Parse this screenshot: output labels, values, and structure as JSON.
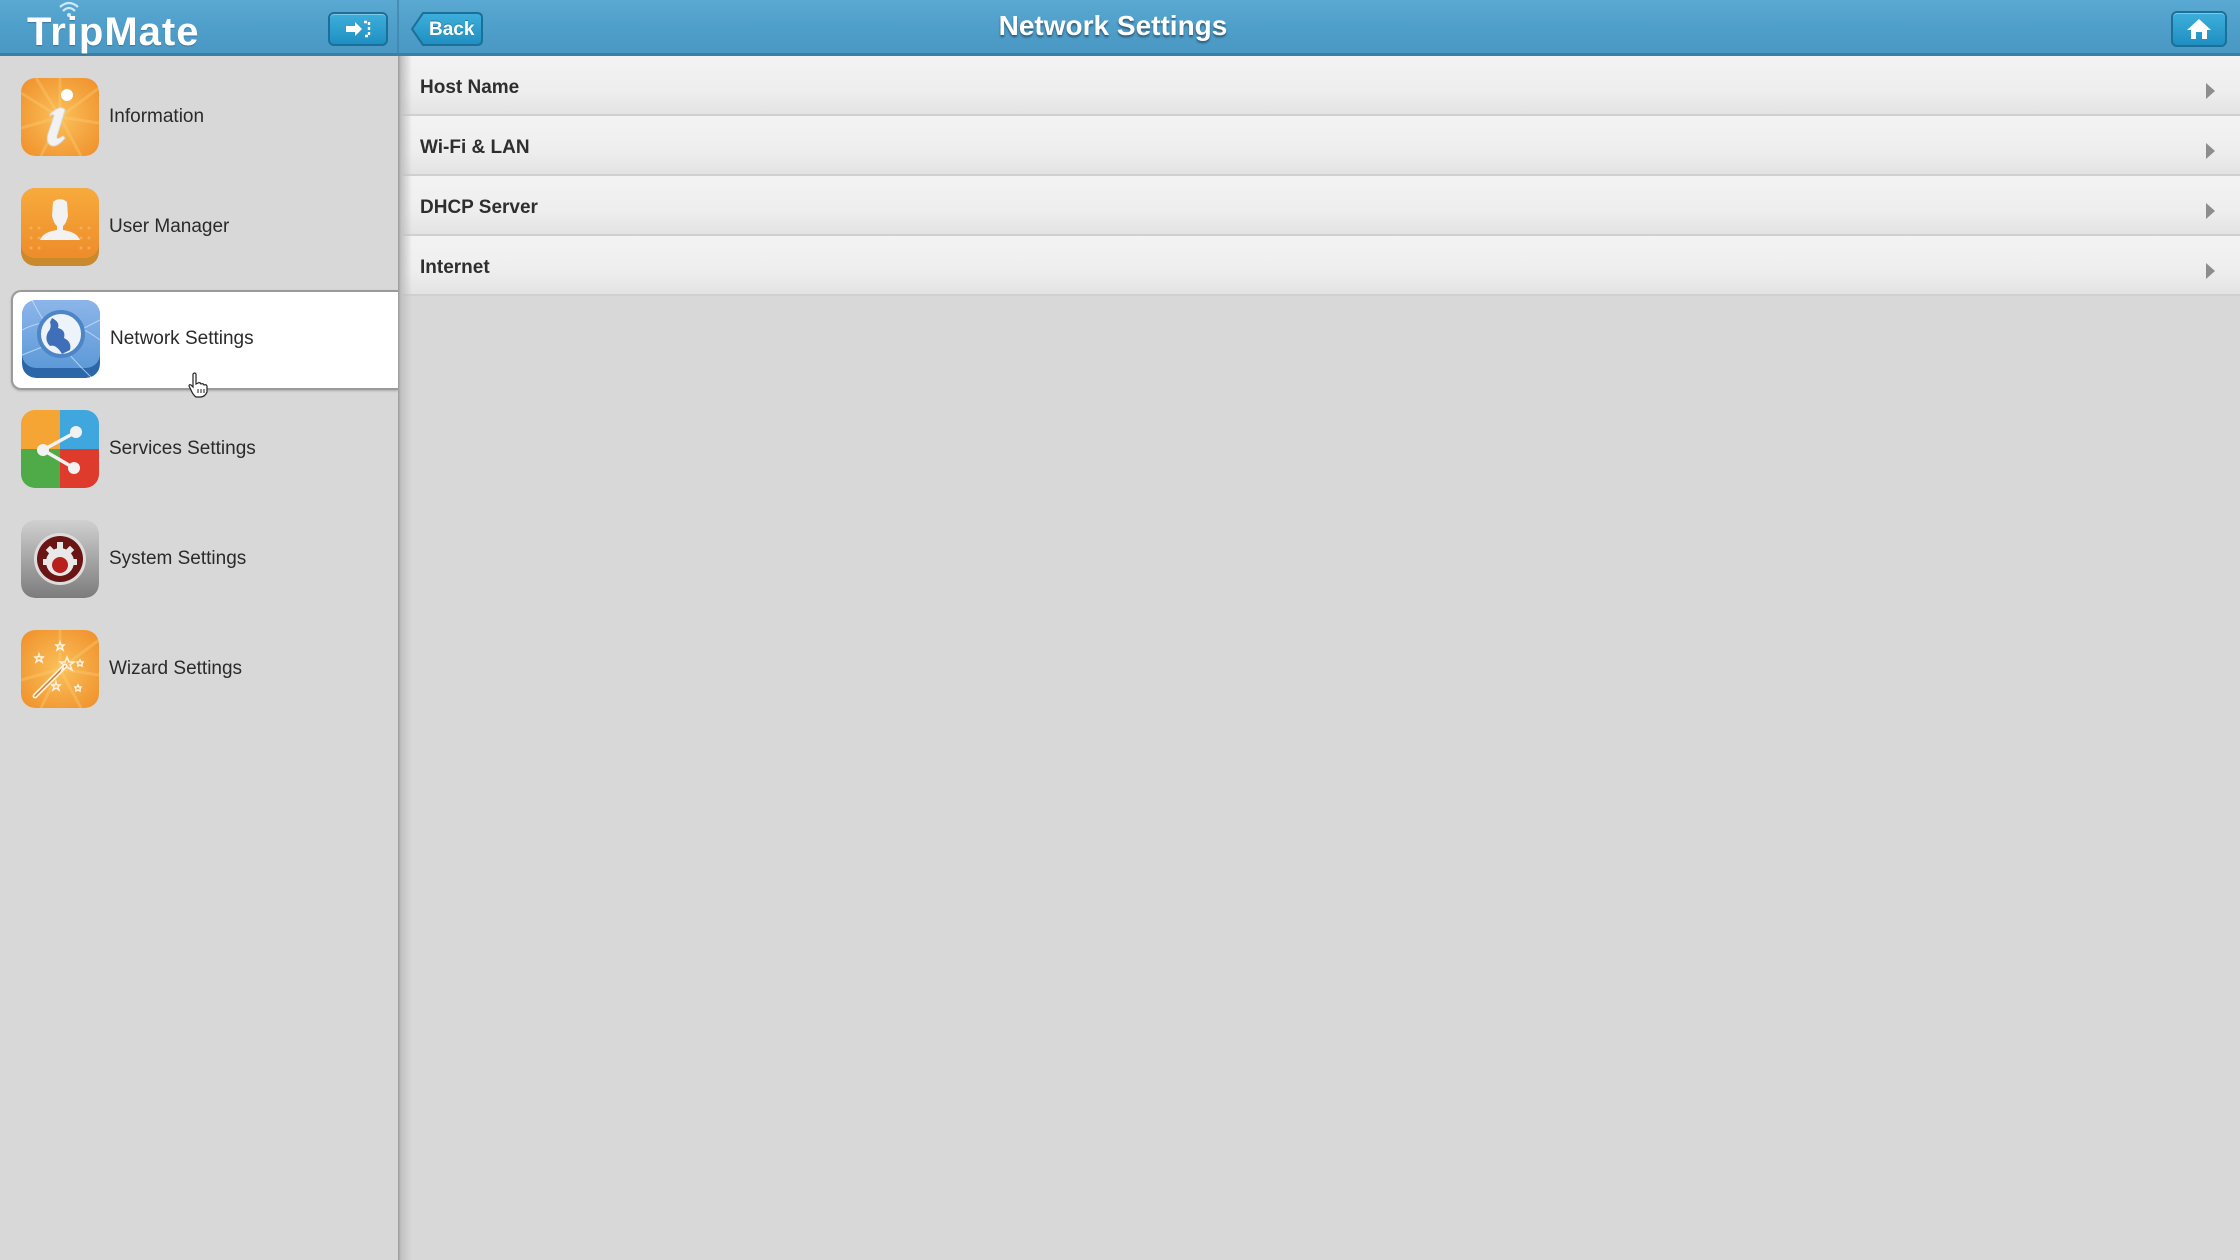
{
  "app": {
    "logo_text": "TripMate",
    "page_title": "Network Settings",
    "back_label": "Back",
    "header_color": "#4f9fcb",
    "button_color": "#2a9dd0"
  },
  "header": {
    "logout_icon": "logout-icon",
    "home_icon": "home-icon"
  },
  "sidebar": {
    "items": [
      {
        "label": "Information",
        "icon": "information-icon",
        "selected": false
      },
      {
        "label": "User Manager",
        "icon": "user-manager-icon",
        "selected": false
      },
      {
        "label": "Network Settings",
        "icon": "globe-icon",
        "selected": true
      },
      {
        "label": "Services Settings",
        "icon": "share-icon",
        "selected": false
      },
      {
        "label": "System Settings",
        "icon": "gear-icon",
        "selected": false
      },
      {
        "label": "Wizard Settings",
        "icon": "magic-wand-icon",
        "selected": false
      }
    ]
  },
  "main": {
    "rows": [
      {
        "label": "Host Name"
      },
      {
        "label": "Wi-Fi & LAN"
      },
      {
        "label": "DHCP Server"
      },
      {
        "label": "Internet"
      }
    ]
  }
}
